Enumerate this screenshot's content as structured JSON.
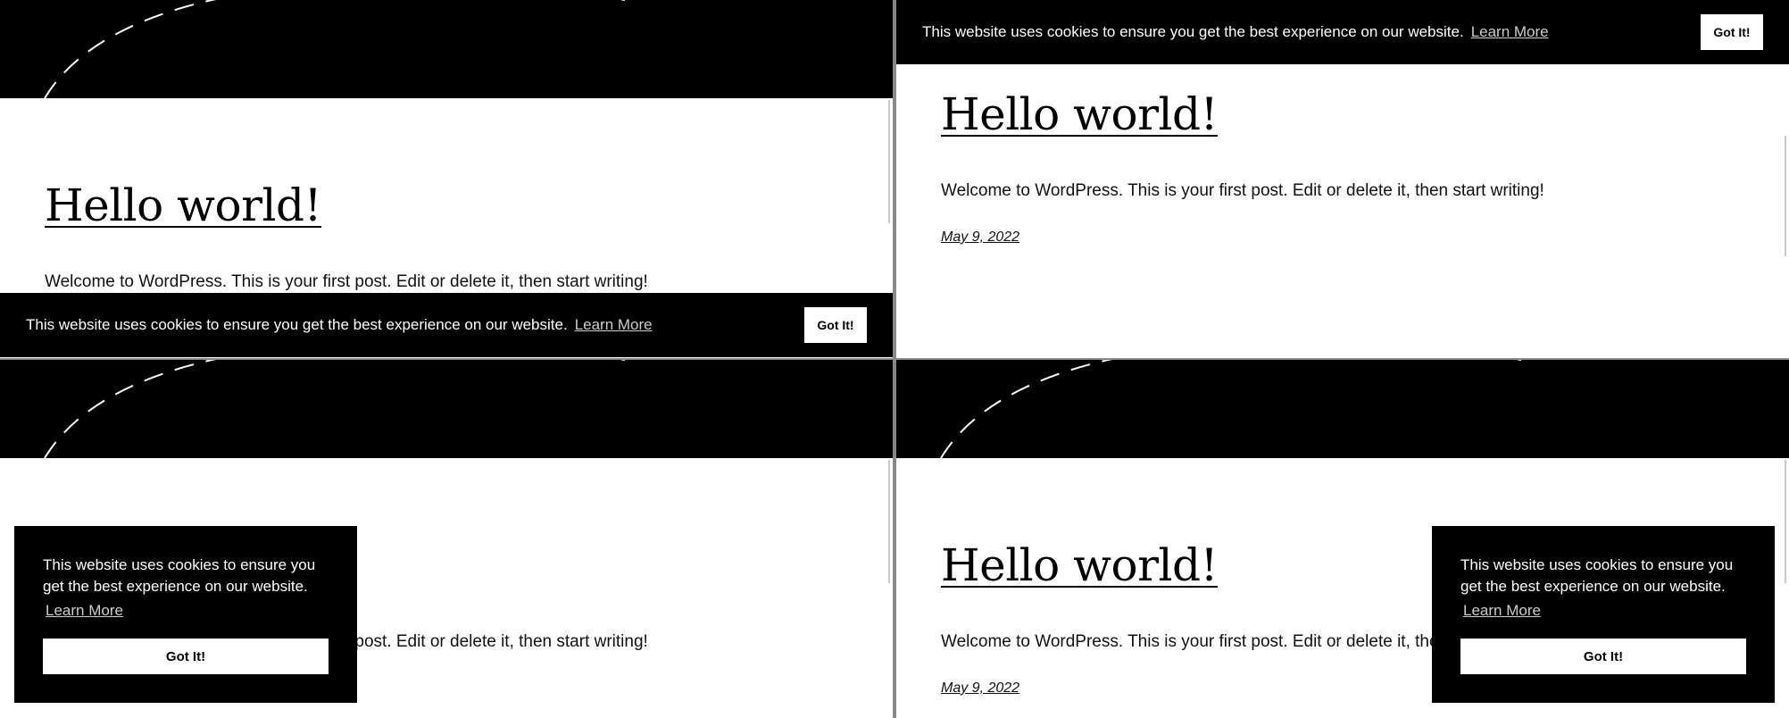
{
  "post": {
    "title": "Hello world!",
    "excerpt": "Welcome to WordPress. This is your first post. Edit or delete it, then start writing!",
    "date": "May 9, 2022"
  },
  "cookie": {
    "message": "This website uses cookies to ensure you get the best experience on our website.",
    "learn_more": "Learn More",
    "accept": "Got It!"
  },
  "colors": {
    "banner_bg": "#000000",
    "banner_text": "#ffffff",
    "button_bg": "#ffffff",
    "link": "#cccccc"
  }
}
